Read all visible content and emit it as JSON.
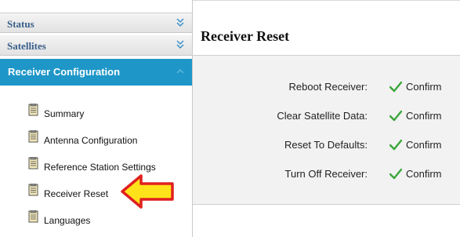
{
  "sidebar": {
    "sections": [
      {
        "label": "Status"
      },
      {
        "label": "Satellites"
      }
    ],
    "active_section": {
      "label": "Receiver Configuration"
    },
    "items": [
      {
        "label": "Summary"
      },
      {
        "label": "Antenna Configuration"
      },
      {
        "label": "Reference Station Settings"
      },
      {
        "label": "Receiver Reset"
      },
      {
        "label": "Languages"
      }
    ]
  },
  "main": {
    "title": "Receiver Reset",
    "rows": [
      {
        "label": "Reboot Receiver:",
        "action": "Confirm"
      },
      {
        "label": "Clear Satellite Data:",
        "action": "Confirm"
      },
      {
        "label": "Reset To Defaults:",
        "action": "Confirm"
      },
      {
        "label": "Turn Off Receiver:",
        "action": "Confirm"
      }
    ]
  },
  "colors": {
    "accent": "#1e96c8",
    "header_text": "#3a5f8a",
    "check": "#3aa63a",
    "arrow_fill": "#ffe21a",
    "arrow_outline": "#e02020"
  },
  "icons": {
    "section_toggle": "double-chevron-down-icon",
    "active_toggle": "chevron-up-icon",
    "item": "document-icon",
    "action": "checkmark-icon",
    "annotation": "arrow-left-icon"
  }
}
